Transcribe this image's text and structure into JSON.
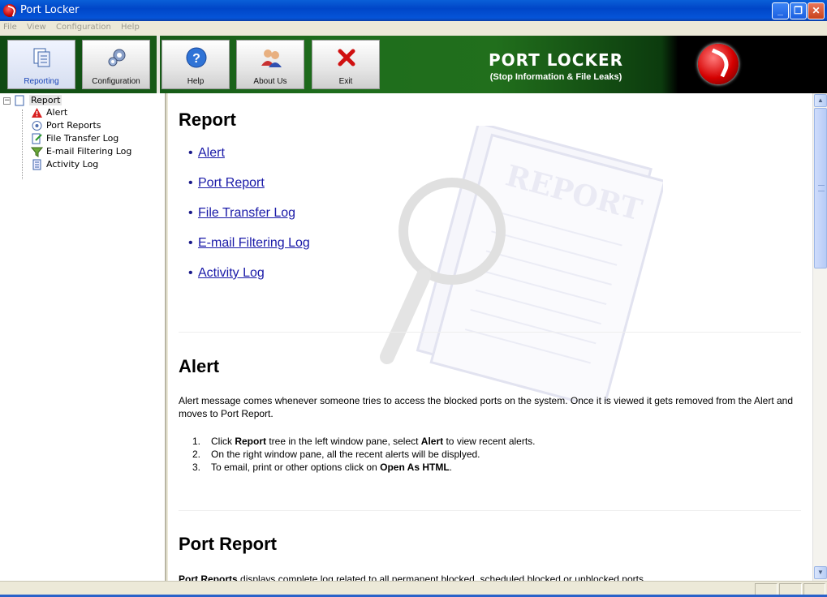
{
  "window": {
    "title": "Port Locker"
  },
  "menu": [
    "File",
    "View",
    "Configuration",
    "Help"
  ],
  "toolbar": {
    "buttons": [
      {
        "label": "Reporting",
        "icon": "reporting-icon"
      },
      {
        "label": "Configuration",
        "icon": "configuration-icon"
      },
      {
        "label": "Help",
        "icon": "help-icon"
      },
      {
        "label": "About Us",
        "icon": "about-us-icon"
      },
      {
        "label": "Exit",
        "icon": "exit-icon"
      }
    ],
    "brand_title": "PORT LOCKER",
    "brand_subtitle": "(Stop Information & File Leaks)"
  },
  "tree": {
    "root": "Report",
    "children": [
      "Alert",
      "Port Reports",
      "File Transfer Log",
      "E-mail Filtering Log",
      "Activity Log"
    ]
  },
  "content": {
    "watermark_text": "REPORT",
    "report_heading": "Report",
    "links": [
      "Alert",
      "Port Report",
      "File Transfer Log",
      "E-mail Filtering Log",
      "Activity Log"
    ],
    "alert_heading": "Alert",
    "alert_para": "Alert message comes whenever someone tries to access the blocked ports on the system. Once it is viewed it gets removed from the Alert and moves to Port Report.",
    "alert_steps": [
      {
        "pre": "Click ",
        "b1": "Report",
        "mid": " tree in the left window pane, select ",
        "b2": "Alert",
        "post": " to view recent alerts."
      },
      {
        "pre": "On the right window pane, all the recent alerts will be displyed.",
        "b1": "",
        "mid": "",
        "b2": "",
        "post": ""
      },
      {
        "pre": "To email, print or other options click on ",
        "b1": "Open As HTML",
        "mid": ".",
        "b2": "",
        "post": ""
      }
    ],
    "port_heading": "Port Report",
    "port_para_bold": "Port Reports",
    "port_para_rest": " displays complete log related to all permanent blocked, scheduled blocked or unblocked ports."
  },
  "colors": {
    "toolbar_green": "#1e6d1c",
    "link_blue": "#1a1aa8",
    "titlebar_blue": "#0046c8"
  }
}
